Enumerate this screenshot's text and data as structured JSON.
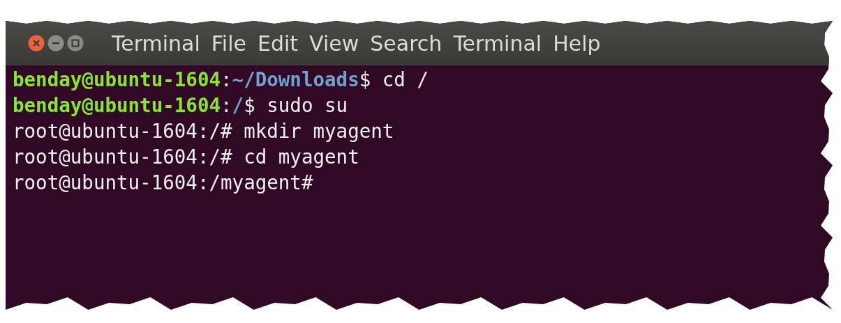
{
  "menu_bar": {
    "app_name": "Terminal",
    "items": [
      "File",
      "Edit",
      "View",
      "Search",
      "Terminal",
      "Help"
    ]
  },
  "terminal": {
    "lines": [
      {
        "segments": [
          {
            "kind": "user",
            "text": "benday@ubuntu-1604"
          },
          {
            "kind": "plain",
            "text": ":"
          },
          {
            "kind": "path",
            "text": "~/Downloads"
          },
          {
            "kind": "plain",
            "text": "$ cd /"
          }
        ]
      },
      {
        "segments": [
          {
            "kind": "user",
            "text": "benday@ubuntu-1604"
          },
          {
            "kind": "plain",
            "text": ":"
          },
          {
            "kind": "path",
            "text": "/"
          },
          {
            "kind": "plain",
            "text": "$ sudo su"
          }
        ]
      },
      {
        "segments": [
          {
            "kind": "plain",
            "text": "root@ubuntu-1604:/# mkdir myagent"
          }
        ]
      },
      {
        "segments": [
          {
            "kind": "plain",
            "text": "root@ubuntu-1604:/# cd myagent"
          }
        ]
      },
      {
        "segments": [
          {
            "kind": "plain",
            "text": "root@ubuntu-1604:/myagent#"
          }
        ]
      }
    ]
  }
}
